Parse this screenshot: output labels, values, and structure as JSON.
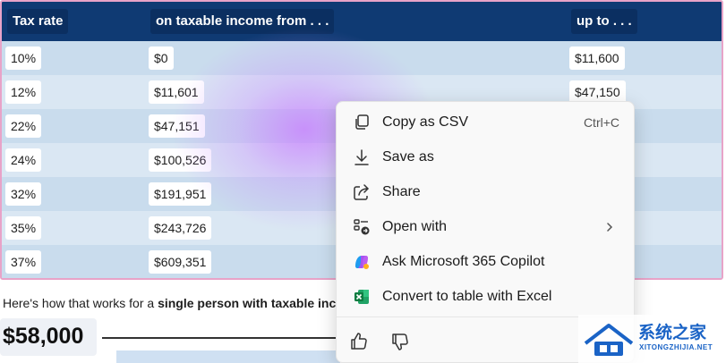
{
  "table": {
    "headers": [
      "Tax rate",
      "on taxable income from . . .",
      "up to . . ."
    ],
    "rows": [
      {
        "rate": "10%",
        "from": "$0",
        "to": "$11,600"
      },
      {
        "rate": "12%",
        "from": "$11,601",
        "to": "$47,150"
      },
      {
        "rate": "22%",
        "from": "$47,151",
        "to": ""
      },
      {
        "rate": "24%",
        "from": "$100,526",
        "to": ""
      },
      {
        "rate": "32%",
        "from": "$191,951",
        "to": ""
      },
      {
        "rate": "35%",
        "from": "$243,726",
        "to": ""
      },
      {
        "rate": "37%",
        "from": "$609,351",
        "to": ""
      }
    ]
  },
  "explanation": {
    "prefix": "Here's how that works for a ",
    "bold": "single person with taxable inc"
  },
  "amount": "$58,000",
  "menu": {
    "items": [
      {
        "label": "Copy as CSV",
        "shortcut": "Ctrl+C",
        "icon": "copy-icon"
      },
      {
        "label": "Save as",
        "icon": "download-icon"
      },
      {
        "label": "Share",
        "icon": "share-icon"
      },
      {
        "label": "Open with",
        "icon": "open-with-icon",
        "submenu": true
      },
      {
        "label": "Ask Microsoft 365 Copilot",
        "icon": "copilot-icon"
      },
      {
        "label": "Convert to table with Excel",
        "icon": "excel-icon"
      }
    ],
    "feedback": [
      "thumbs-up-icon",
      "thumbs-down-icon"
    ]
  },
  "watermark": {
    "title": "系统之家",
    "subtitle": "XITONGZHIJIA.NET"
  },
  "colors": {
    "header_bg": "#0f3a73",
    "row_alt": "#c9dced",
    "row_norm": "#dae7f3",
    "accent_border": "#e8a3c8",
    "excel_green": "#107c41",
    "watermark_blue": "#1a63c6"
  }
}
